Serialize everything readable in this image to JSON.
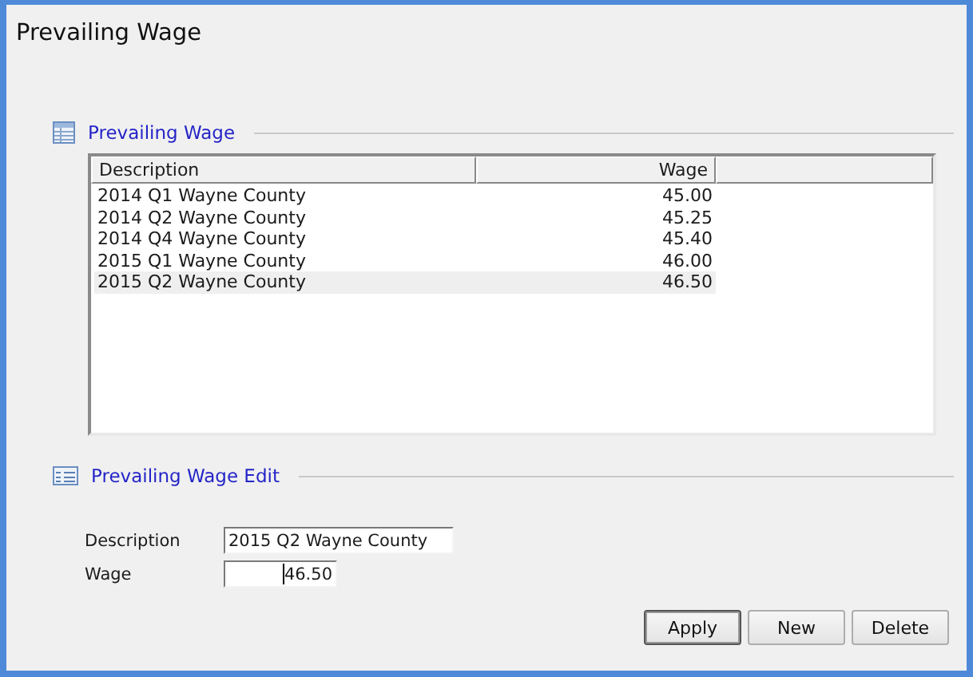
{
  "window": {
    "title": "Prevailing Wage"
  },
  "list_section": {
    "title": "Prevailing Wage"
  },
  "table": {
    "columns": [
      "Description",
      "Wage"
    ],
    "rows": [
      {
        "description": "2014 Q1 Wayne County",
        "wage": "45.00",
        "selected": false
      },
      {
        "description": "2014 Q2 Wayne County",
        "wage": "45.25",
        "selected": false
      },
      {
        "description": "2014 Q4 Wayne County",
        "wage": "45.40",
        "selected": false
      },
      {
        "description": "2015 Q1 Wayne County",
        "wage": "46.00",
        "selected": false
      },
      {
        "description": "2015 Q2 Wayne County",
        "wage": "46.50",
        "selected": true
      }
    ]
  },
  "edit_section": {
    "title": "Prevailing Wage Edit"
  },
  "fields": [
    {
      "label": "Description",
      "value": "2015 Q2 Wayne County",
      "kind": "text",
      "focused": false
    },
    {
      "label": "Wage",
      "value": "46.50",
      "kind": "number",
      "focused": true
    }
  ],
  "buttons": [
    {
      "label": "Apply",
      "default": true
    },
    {
      "label": "New",
      "default": false
    },
    {
      "label": "Delete",
      "default": false
    }
  ]
}
